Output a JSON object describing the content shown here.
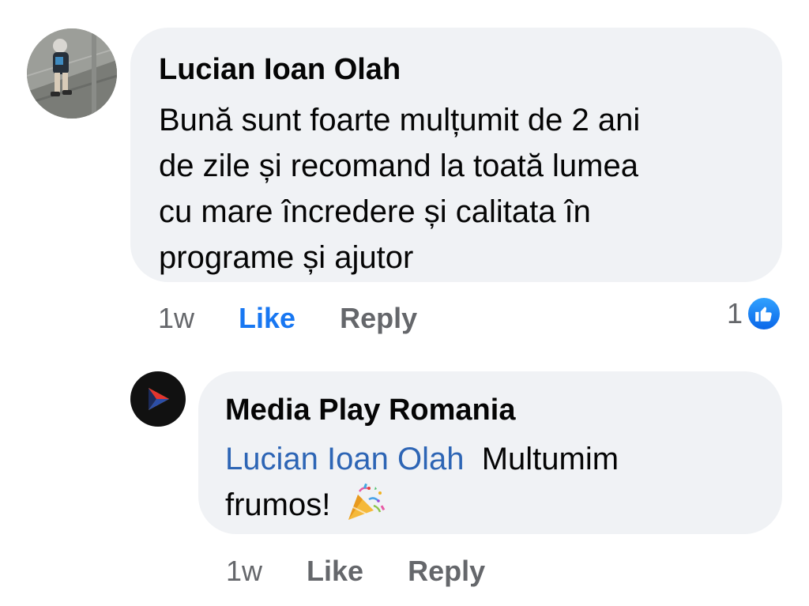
{
  "comment": {
    "author": "Lucian Ioan Olah",
    "text_lines": [
      "Bună sunt foarte mulțumit de 2 ani",
      "de zile și recomand la toată lumea",
      "cu mare încredere și calitata în",
      "programe și ajutor"
    ],
    "time": "1w",
    "like_label": "Like",
    "reply_label": "Reply",
    "reaction_count": "1",
    "reaction_icon": "thumbs-up-icon",
    "like_active_color": "#1877f2"
  },
  "reply": {
    "author": "Media Play Romania",
    "mention": "Lucian Ioan Olah",
    "text_first": "Multumim",
    "text_second": "frumos!",
    "emoji": "party-popper-icon",
    "time": "1w",
    "like_label": "Like",
    "reply_label": "Reply"
  },
  "colors": {
    "bubble": "#f0f2f5",
    "meta": "#65676b",
    "link": "#2d65b5"
  }
}
